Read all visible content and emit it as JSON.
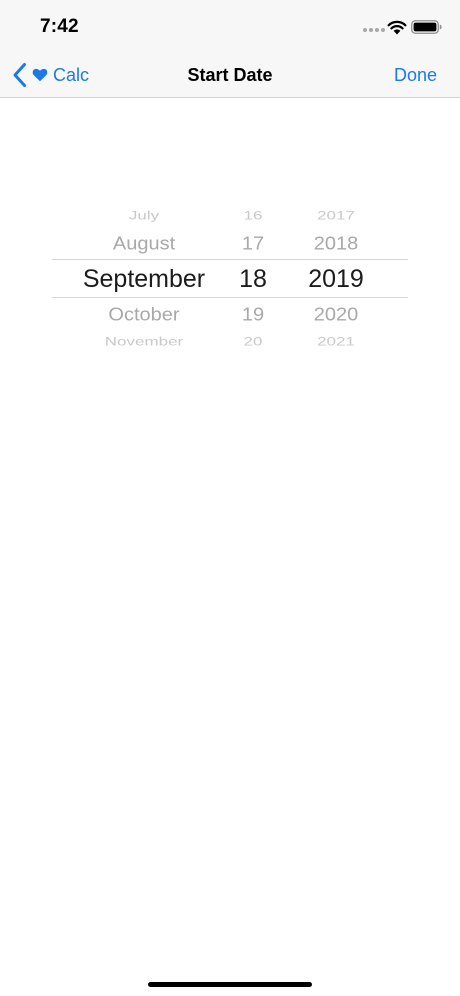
{
  "status_bar": {
    "time": "7:42"
  },
  "nav_bar": {
    "back_label": "Calc",
    "title": "Start Date",
    "done_label": "Done"
  },
  "date_picker": {
    "months": [
      "July",
      "August",
      "September",
      "October",
      "November"
    ],
    "days": [
      "16",
      "17",
      "18",
      "19",
      "20"
    ],
    "years": [
      "2017",
      "2018",
      "2019",
      "2020",
      "2021"
    ],
    "selected": {
      "month": "September",
      "day": "18",
      "year": "2019"
    }
  },
  "colors": {
    "accent": "#1a7ae8",
    "bar_background": "#f7f7f7",
    "picker_selected": "#1c1c1c",
    "picker_unselected": "#a9a9a9"
  }
}
